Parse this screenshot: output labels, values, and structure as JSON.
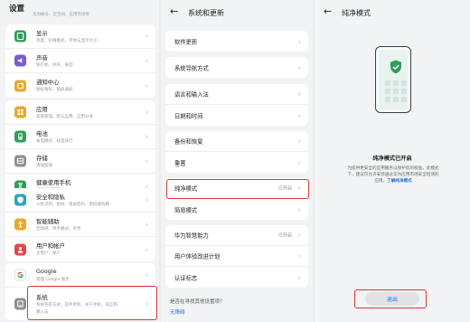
{
  "settings": {
    "title": "设置",
    "cut_text": "华为帐号、云空间、应用市场等",
    "items": [
      {
        "label": "显示",
        "sub": "亮度、护眼模式、字体与显示大小",
        "icon": "display-icon",
        "color": "#2e9e5b"
      },
      {
        "label": "声音",
        "sub": "免打扰、铃声、振动",
        "icon": "sound-icon",
        "color": "#7a5cd6"
      },
      {
        "label": "通知中心",
        "sub": "图标角标、锁屏通知",
        "icon": "notification-icon",
        "color": "#e6a928"
      },
      {
        "label": "应用",
        "sub": "权限管理、默认应用、应用分身",
        "icon": "apps-icon",
        "color": "#e6a928"
      },
      {
        "label": "电池",
        "sub": "省电模式、耗电排行",
        "icon": "battery-icon",
        "color": "#2e9e5b"
      },
      {
        "label": "存储",
        "sub": "清理加速",
        "icon": "storage-icon",
        "color": "#8d8f93"
      },
      {
        "label": "健康使用手机",
        "sub": "屏幕时间管理",
        "icon": "hourglass-icon",
        "color": "#2e9e5b"
      },
      {
        "label": "安全和隐私",
        "sub": "人脸识别、指纹、锁屏密码、密码保险箱",
        "icon": "shield-icon",
        "color": "#2aa4bd"
      },
      {
        "label": "智能辅助",
        "sub": "无障碍、单手模式、手势",
        "icon": "assist-icon",
        "color": "#e6a928"
      },
      {
        "label": "用户和帐户",
        "sub": "多用户、帐户",
        "icon": "user-icon",
        "color": "#e2474b"
      },
      {
        "label": "Google",
        "sub": "管理 Google 服务",
        "icon": "google-icon",
        "color": "#ffffff"
      },
      {
        "label": "系统",
        "sub": "系统导航方式、软件更新、关于手机、语言和",
        "sub2": "输入法",
        "icon": "system-icon",
        "color": "#8d8f93"
      }
    ]
  },
  "system": {
    "back": "←",
    "title": "系统和更新",
    "groups": [
      [
        {
          "label": "软件更新"
        }
      ],
      [
        {
          "label": "系统导航方式"
        }
      ],
      [
        {
          "label": "语言和输入法"
        },
        {
          "label": "日期和时间"
        }
      ],
      [
        {
          "label": "备份和恢复"
        },
        {
          "label": "重置"
        }
      ],
      [
        {
          "label": "纯净模式",
          "value": "已开启"
        },
        {
          "label": "简易模式"
        }
      ],
      [
        {
          "label": "华为智慧能力",
          "value": "已开启"
        },
        {
          "label": "用户体验改进计划"
        },
        {
          "label": "认证标志"
        }
      ]
    ],
    "question": "是否在寻找其他设置项？",
    "link": "无障碍"
  },
  "pure_mode": {
    "back": "←",
    "title": "纯净模式",
    "status": "纯净模式已开启",
    "desc1": "为提供更安全的应用服务以保护您的权益，此模式",
    "desc2": "下，建议仅允许安装通过华为应用市场安全检测的",
    "desc3": "应用。",
    "link": "了解纯净模式",
    "exit": "退出"
  },
  "colors": {
    "accent": "#2f6fd6",
    "highlight": "#e0353b",
    "shield_green": "#2e9e5b"
  }
}
